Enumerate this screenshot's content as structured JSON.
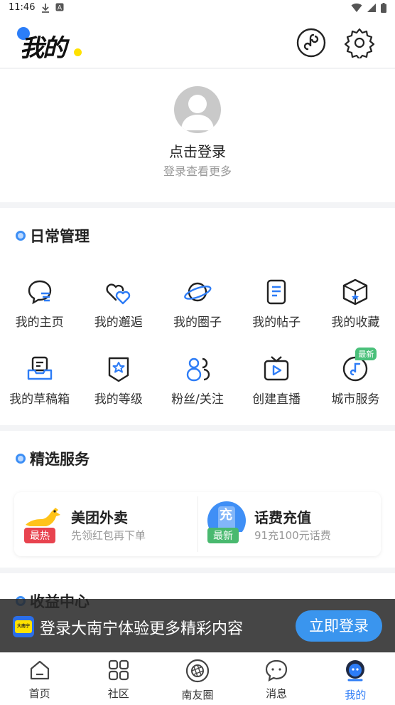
{
  "status_bar": {
    "time": "11:46"
  },
  "header": {
    "title": "我的"
  },
  "profile": {
    "login_title": "点击登录",
    "login_subtitle": "登录查看更多"
  },
  "daily": {
    "title": "日常管理",
    "items": [
      {
        "label": "我的主页",
        "icon": "chat-bubble-icon"
      },
      {
        "label": "我的邂逅",
        "icon": "hearts-icon"
      },
      {
        "label": "我的圈子",
        "icon": "planet-icon"
      },
      {
        "label": "我的帖子",
        "icon": "document-icon"
      },
      {
        "label": "我的收藏",
        "icon": "box-icon"
      },
      {
        "label": "我的草稿箱",
        "icon": "inbox-icon"
      },
      {
        "label": "我的等级",
        "icon": "shield-star-icon"
      },
      {
        "label": "粉丝/关注",
        "icon": "followers-icon"
      },
      {
        "label": "创建直播",
        "icon": "tv-play-icon"
      },
      {
        "label": "城市服务",
        "icon": "music-note-icon",
        "badge": "最新"
      }
    ]
  },
  "featured": {
    "title": "精选服务",
    "services": [
      {
        "name": "美团外卖",
        "desc": "先领红包再下单",
        "badge": "最热",
        "badge_color": "#e8434f"
      },
      {
        "name": "话费充值",
        "desc": "91充100元话费",
        "badge": "最新",
        "badge_color": "#49b96f",
        "icon_text": "充"
      }
    ]
  },
  "income": {
    "title": "收益中心"
  },
  "banner": {
    "logo_text": "大南宁",
    "text": "登录大南宁体验更多精彩内容",
    "button": "立即登录"
  },
  "tabbar": {
    "tabs": [
      {
        "label": "首页",
        "icon": "home-icon"
      },
      {
        "label": "社区",
        "icon": "grid-icon"
      },
      {
        "label": "南友圈",
        "icon": "aperture-icon"
      },
      {
        "label": "消息",
        "icon": "message-icon"
      },
      {
        "label": "我的",
        "icon": "profile-icon",
        "active": true
      }
    ]
  },
  "colors": {
    "accent": "#2d7cf6",
    "text": "#222222"
  }
}
